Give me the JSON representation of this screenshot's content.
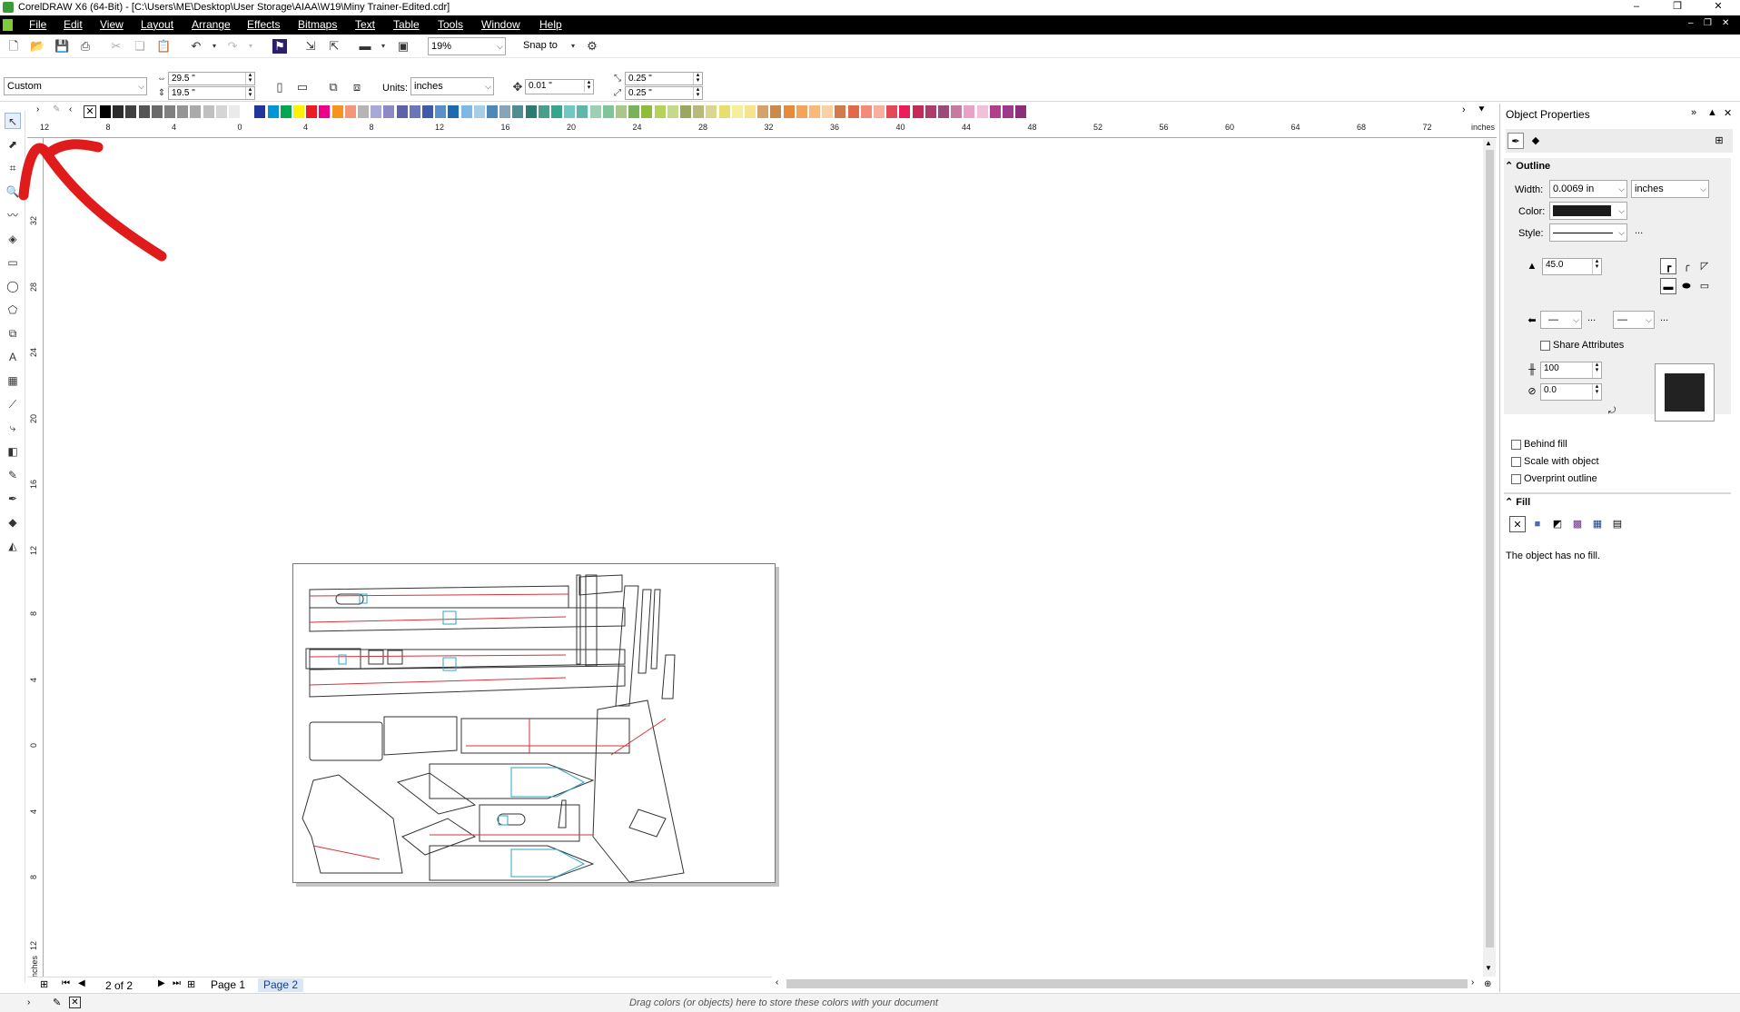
{
  "window": {
    "title": "CorelDRAW X6 (64-Bit) - [C:\\Users\\ME\\Desktop\\User Storage\\AIAA\\W19\\Miny Trainer-Edited.cdr]",
    "controls": [
      "–",
      "❐",
      "✕"
    ]
  },
  "menu": [
    "File",
    "Edit",
    "View",
    "Layout",
    "Arrange",
    "Effects",
    "Bitmaps",
    "Text",
    "Table",
    "Tools",
    "Window",
    "Help"
  ],
  "toolbar": {
    "zoom": "19%",
    "snap_to": "Snap to"
  },
  "property_bar": {
    "page_preset": "Custom",
    "width": "29.5 \"",
    "height": "19.5 \"",
    "units_label": "Units:",
    "units": "inches",
    "nudge": "0.01 \"",
    "dup_x": "0.25 \"",
    "dup_y": "0.25 \""
  },
  "palette_colors": [
    "#000000",
    "#2b2b2b",
    "#404040",
    "#555555",
    "#6a6a6a",
    "#808080",
    "#959595",
    "#aaaaaa",
    "#c0c0c0",
    "#d5d5d5",
    "#eaeaea",
    "#ffffff",
    "#22369a",
    "#0096d6",
    "#00a650",
    "#fff200",
    "#ed1c24",
    "#ec008c",
    "#f7941d",
    "#f69679",
    "#b5b5b5",
    "#a7a9d7",
    "#8c89c4",
    "#5e62ad",
    "#6b76b8",
    "#3f5aa8",
    "#5a90c9",
    "#1d6ab3",
    "#7fb8e4",
    "#a5cfe8",
    "#4e87b9",
    "#87a4b8",
    "#4f8d93",
    "#2b7b70",
    "#4a9e8a",
    "#35a58c",
    "#71c8c2",
    "#5fb7a8",
    "#9bd0b5",
    "#80c49a",
    "#a9c78b",
    "#7ab25a",
    "#8fbc3a",
    "#b4d25c",
    "#c4d98a",
    "#9aa75e",
    "#b7bb7a",
    "#d9d78f",
    "#e6de6d",
    "#f5ee9a",
    "#f7e48a",
    "#d4a36d",
    "#c98a4b",
    "#e88a3c",
    "#f4a45a",
    "#f9b97a",
    "#fbd1a3",
    "#d27a4d",
    "#e2694b",
    "#f28b77",
    "#f7b0a0",
    "#e24a55",
    "#ea1f59",
    "#c42b57",
    "#ad3d6a",
    "#9b4a7a",
    "#c77aa0",
    "#e9a1c5",
    "#f2c0d8",
    "#b0408b",
    "#a0388c",
    "#8c2f7a"
  ],
  "ruler": {
    "h_ticks": [
      "12",
      "8",
      "4",
      "0",
      "4",
      "8",
      "12",
      "16",
      "20",
      "24",
      "28",
      "32",
      "36",
      "40",
      "44",
      "48",
      "52",
      "56",
      "60",
      "64",
      "68",
      "72"
    ],
    "unit": "inches",
    "v_ticks": [
      "32",
      "28",
      "24",
      "20",
      "16",
      "12",
      "8",
      "4",
      "0",
      "4",
      "8",
      "12"
    ],
    "v_unit": "inches"
  },
  "page_nav": {
    "counter": "2 of 2",
    "tabs": [
      "Page 1",
      "Page 2"
    ]
  },
  "status": {
    "hint": "Drag colors (or objects) here to store these colors with your document"
  },
  "docker": {
    "title": "Object Properties",
    "outline": {
      "header": "Outline",
      "width_label": "Width:",
      "width": "0.0069 in",
      "width_units": "inches",
      "color_label": "Color:",
      "color": "#1a1a1a",
      "style_label": "Style:",
      "more": "...",
      "miter": "45.0",
      "share_attributes": "Share Attributes",
      "stretch": "100",
      "angle": "0.0",
      "behind_fill": "Behind fill",
      "scale_with_object": "Scale with object",
      "overprint_outline": "Overprint outline"
    },
    "fill": {
      "header": "Fill",
      "message": "The object has no fill."
    }
  }
}
